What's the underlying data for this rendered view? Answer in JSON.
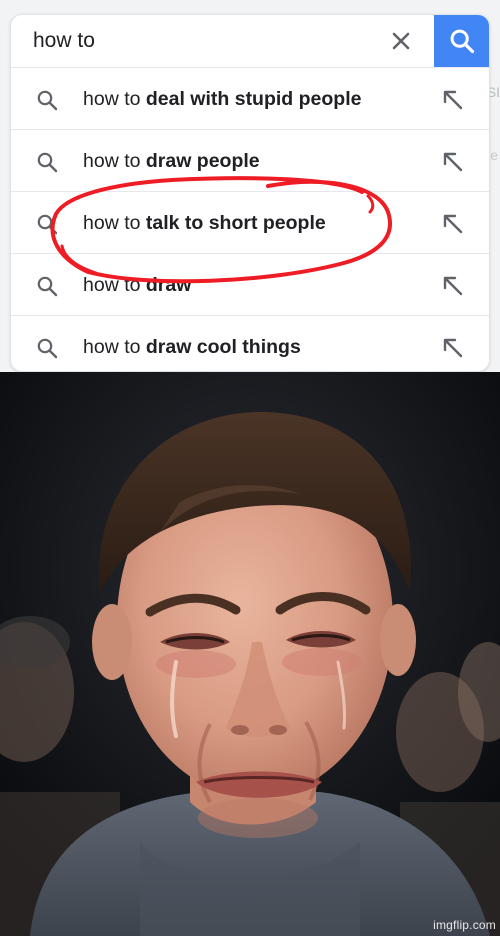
{
  "search": {
    "query": "how to"
  },
  "suggestions": [
    {
      "prefix": "how to ",
      "bold": "deal with stupid people"
    },
    {
      "prefix": "how to ",
      "bold": "draw people"
    },
    {
      "prefix": "how to ",
      "bold": "talk to short people"
    },
    {
      "prefix": "how to ",
      "bold": "draw"
    },
    {
      "prefix": "how to ",
      "bold": "draw cool things"
    }
  ],
  "background_ghost": {
    "text_1": "SI",
    "text_2": "e"
  },
  "annotation": {
    "color": "#ee1c24"
  },
  "colors": {
    "search_button": "#4285f4",
    "icon_gray": "#5f6368"
  },
  "icons": {
    "clear": "close-icon",
    "search": "search-icon",
    "suggestion": "search-icon",
    "fill": "arrow-up-left-icon"
  },
  "photo": {
    "watermark": "imgflip.com"
  }
}
